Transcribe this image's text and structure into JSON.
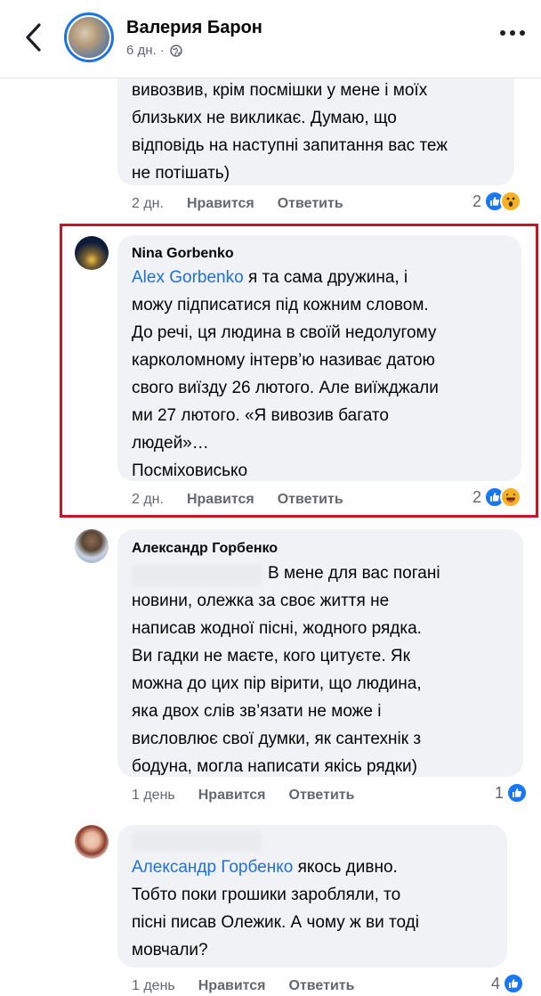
{
  "header": {
    "name": "Валерия Барон",
    "meta": "6 дн. ·"
  },
  "comment0": {
    "lines": [
      "вивозвив, крім посмішки у мене і моїх",
      "близьких не викликає. Думаю, що",
      "відповідь на наступні запитання вас теж",
      "не потішать)"
    ],
    "time": "2 дн.",
    "like": "Нравится",
    "reply": "Ответить",
    "reactions": "2"
  },
  "comment1": {
    "author": "Nina Gorbenko",
    "mention": "Alex Gorbenko",
    "first_line_rest": " я та сама дружина, і",
    "lines": [
      "можу підписатися під кожним словом.",
      "До речі, ця людина в своїй недолугому",
      "карколомному інтерв’ю називає датою",
      "свого виїзду 26 лютого. Але виїжджали",
      "ми 27 лютого. «Я вивозив багато",
      "людей»…",
      "Посміховисько"
    ],
    "time": "2 дн.",
    "like": "Нравится",
    "reply": "Ответить",
    "reactions": "2"
  },
  "comment2": {
    "author": "Александр Горбенко",
    "first_line": "В мене для вас погані",
    "lines": [
      "новини, олежка за своє життя не",
      "написав жодної пісні, жодного рядка.",
      "Ви гадки не маєте, кого цитуєте. Як",
      "можна до цих пір вірити, що людина,",
      "яка двох слів зв’язати не може і",
      "висловлює свої думки, як сантехнік з",
      "бодуна, могла написати якісь рядки)"
    ],
    "time": "1 день",
    "like": "Нравится",
    "reply": "Ответить",
    "reactions": "1"
  },
  "comment3": {
    "mention": "Александр Горбенко",
    "first_line_rest": "  якось дивно.",
    "lines": [
      "Тобто поки грошики заробляли,  то",
      "пісні писав Олежик.  А чому ж ви  тоді",
      "мовчали?"
    ],
    "time": "1 день",
    "like": "Нравится",
    "reply": "Ответить",
    "reactions": "4"
  },
  "colors": {
    "accent": "#216fdb",
    "like": "#1877f2",
    "highlight": "#c8142b",
    "bubble": "#f0f2f5"
  }
}
